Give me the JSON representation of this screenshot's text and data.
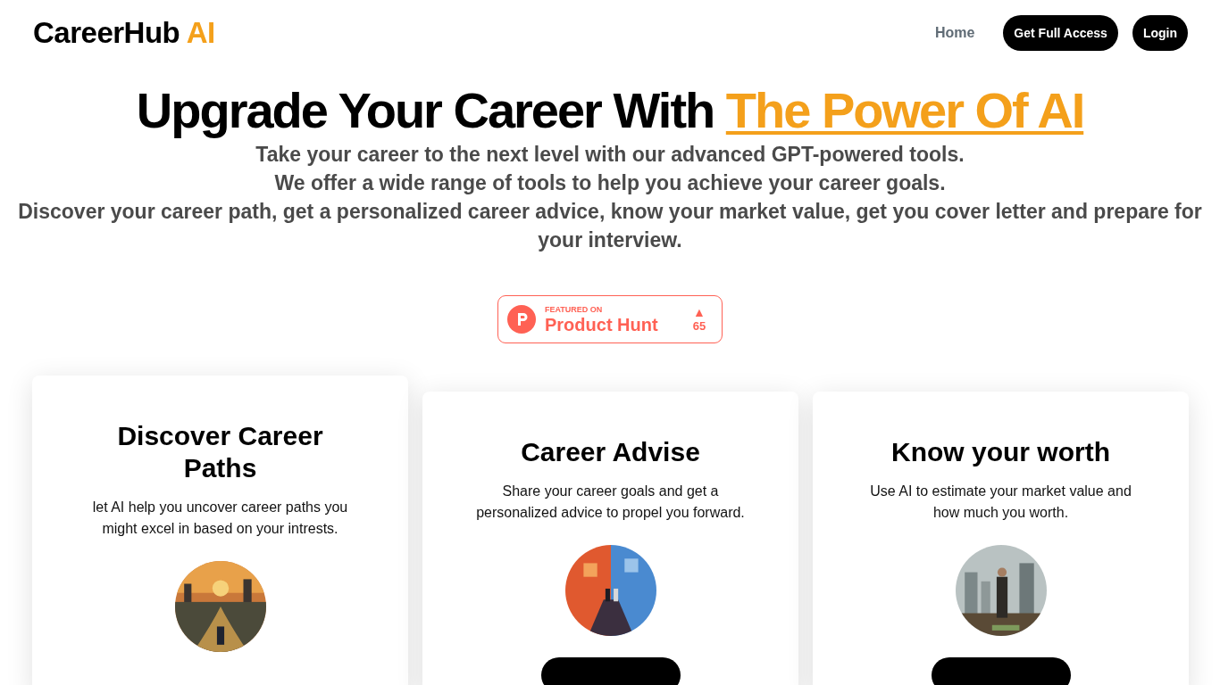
{
  "header": {
    "logo": {
      "name": "CareerHub",
      "accent": "AI"
    },
    "nav": [
      {
        "kind": "link",
        "label": "Home"
      },
      {
        "kind": "pill",
        "label": "Get Full Access"
      },
      {
        "kind": "pill",
        "label": "Login"
      }
    ]
  },
  "hero": {
    "title": "Upgrade Your Career With",
    "title_highlight": "The Power Of AI",
    "lines": [
      "Take your career to the next level with our advanced GPT-powered tools.",
      "We offer a wide range of tools to help you achieve your career goals.",
      "Discover your career path, get a personalized career advice, know your market value, get you cover letter and prepare for your interview."
    ]
  },
  "badge": {
    "caption": "FEATURED ON",
    "name": "Product Hunt",
    "arrow": "▲",
    "votes": "65"
  },
  "cards": [
    {
      "title": "Discover Career Paths",
      "text": "let AI help you uncover career paths you might excel in based on your intrests.",
      "raised": true,
      "has_button": false
    },
    {
      "title": "Career Advise",
      "text": "Share your career goals and get a personalized advice to propel you forward.",
      "raised": false,
      "has_button": true
    },
    {
      "title": "Know your worth",
      "text": "Use AI to estimate your market value and how much you worth.",
      "raised": false,
      "has_button": true
    }
  ]
}
